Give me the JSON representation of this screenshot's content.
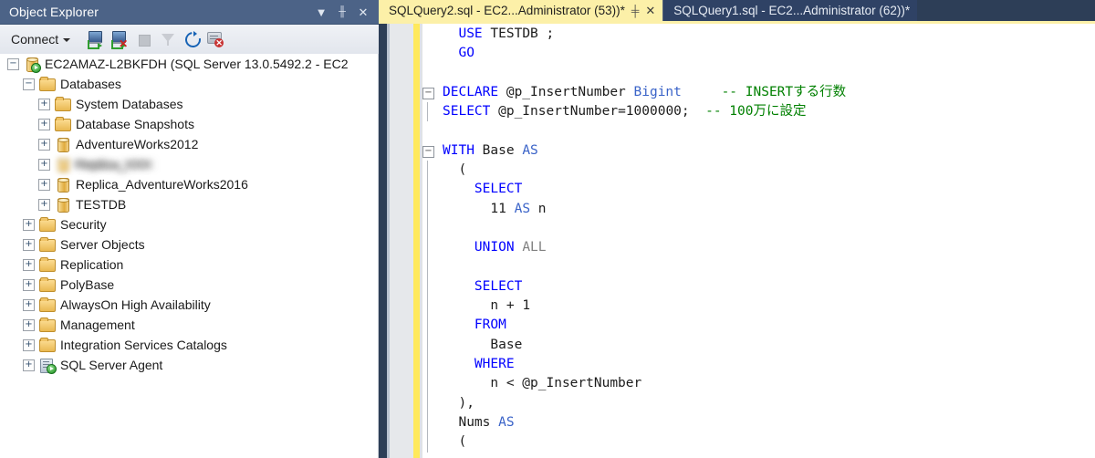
{
  "object_explorer": {
    "title": "Object Explorer",
    "title_buttons": [
      {
        "name": "dropdown",
        "glyph": "▼"
      },
      {
        "name": "pin",
        "glyph": "▮"
      },
      {
        "name": "close",
        "glyph": "✕"
      }
    ],
    "toolbar": {
      "connect_label": "Connect",
      "icons": [
        "connect-icon",
        "disconnect-icon",
        "stop-icon",
        "filter-icon",
        "refresh-icon",
        "disconnect-all-icon"
      ]
    },
    "tree": [
      {
        "label": "EC2AMAZ-L2BKFDH (SQL Server 13.0.5492.2 - EC2",
        "indent": 0,
        "expander": "−",
        "icon": "server-icon",
        "redacted": false
      },
      {
        "label": "Databases",
        "indent": 1,
        "expander": "−",
        "icon": "folder-icon",
        "redacted": false
      },
      {
        "label": "System Databases",
        "indent": 2,
        "expander": "+",
        "icon": "folder-icon",
        "redacted": false
      },
      {
        "label": "Database Snapshots",
        "indent": 2,
        "expander": "+",
        "icon": "folder-icon",
        "redacted": false
      },
      {
        "label": "AdventureWorks2012",
        "indent": 2,
        "expander": "+",
        "icon": "database-icon",
        "redacted": false
      },
      {
        "label": "Replica_XXX",
        "indent": 2,
        "expander": "+",
        "icon": "database-icon",
        "redacted": true
      },
      {
        "label": "Replica_AdventureWorks2016",
        "indent": 2,
        "expander": "+",
        "icon": "database-icon",
        "redacted": false
      },
      {
        "label": "TESTDB",
        "indent": 2,
        "expander": "+",
        "icon": "database-icon",
        "redacted": false
      },
      {
        "label": "Security",
        "indent": 1,
        "expander": "+",
        "icon": "folder-icon",
        "redacted": false
      },
      {
        "label": "Server Objects",
        "indent": 1,
        "expander": "+",
        "icon": "folder-icon",
        "redacted": false
      },
      {
        "label": "Replication",
        "indent": 1,
        "expander": "+",
        "icon": "folder-icon",
        "redacted": false
      },
      {
        "label": "PolyBase",
        "indent": 1,
        "expander": "+",
        "icon": "folder-icon",
        "redacted": false
      },
      {
        "label": "AlwaysOn High Availability",
        "indent": 1,
        "expander": "+",
        "icon": "folder-icon",
        "redacted": false
      },
      {
        "label": "Management",
        "indent": 1,
        "expander": "+",
        "icon": "folder-icon",
        "redacted": false
      },
      {
        "label": "Integration Services Catalogs",
        "indent": 1,
        "expander": "+",
        "icon": "folder-icon",
        "redacted": false
      },
      {
        "label": "SQL Server Agent",
        "indent": 1,
        "expander": "+",
        "icon": "agent-icon",
        "redacted": false
      }
    ]
  },
  "editor": {
    "tabs": [
      {
        "label": "SQLQuery2.sql - EC2...Administrator (53))*",
        "active": true,
        "pin_glyph": "⎯",
        "close_glyph": "✕"
      },
      {
        "label": "SQLQuery1.sql - EC2...Administrator (62))*",
        "active": false,
        "pin_glyph": "",
        "close_glyph": ""
      }
    ],
    "lines": [
      {
        "fold": "",
        "vline": false,
        "tokens": [
          {
            "t": "  ",
            "c": "plain"
          },
          {
            "t": "USE",
            "c": "kw"
          },
          {
            "t": " TESTDB ;",
            "c": "plain"
          }
        ]
      },
      {
        "fold": "",
        "vline": false,
        "tokens": [
          {
            "t": "  ",
            "c": "plain"
          },
          {
            "t": "GO",
            "c": "kw"
          }
        ]
      },
      {
        "fold": "",
        "vline": false,
        "tokens": []
      },
      {
        "fold": "−",
        "vline": false,
        "tokens": [
          {
            "t": "DECLARE",
            "c": "kw"
          },
          {
            "t": " @p_InsertNumber ",
            "c": "plain"
          },
          {
            "t": "Bigint",
            "c": "kw2"
          },
          {
            "t": "     ",
            "c": "plain"
          },
          {
            "t": "-- INSERTする行数",
            "c": "cmt"
          }
        ]
      },
      {
        "fold": "",
        "vline": true,
        "tokens": [
          {
            "t": "SELECT",
            "c": "kw"
          },
          {
            "t": " @p_InsertNumber=",
            "c": "plain"
          },
          {
            "t": "1000000",
            "c": "num"
          },
          {
            "t": ";  ",
            "c": "plain"
          },
          {
            "t": "-- 100万に設定",
            "c": "cmt"
          }
        ]
      },
      {
        "fold": "",
        "vline": false,
        "tokens": []
      },
      {
        "fold": "−",
        "vline": false,
        "tokens": [
          {
            "t": "WITH",
            "c": "kw"
          },
          {
            "t": " Base ",
            "c": "plain"
          },
          {
            "t": "AS",
            "c": "kw2"
          }
        ]
      },
      {
        "fold": "",
        "vline": true,
        "tokens": [
          {
            "t": "  (",
            "c": "plain"
          }
        ]
      },
      {
        "fold": "",
        "vline": true,
        "tokens": [
          {
            "t": "    ",
            "c": "plain"
          },
          {
            "t": "SELECT",
            "c": "kw"
          }
        ]
      },
      {
        "fold": "",
        "vline": true,
        "tokens": [
          {
            "t": "      ",
            "c": "plain"
          },
          {
            "t": "11",
            "c": "num"
          },
          {
            "t": " ",
            "c": "plain"
          },
          {
            "t": "AS",
            "c": "kw2"
          },
          {
            "t": " n",
            "c": "plain"
          }
        ]
      },
      {
        "fold": "",
        "vline": true,
        "tokens": []
      },
      {
        "fold": "",
        "vline": true,
        "tokens": [
          {
            "t": "    ",
            "c": "plain"
          },
          {
            "t": "UNION",
            "c": "kw"
          },
          {
            "t": " ",
            "c": "plain"
          },
          {
            "t": "ALL",
            "c": "gray"
          }
        ]
      },
      {
        "fold": "",
        "vline": true,
        "tokens": []
      },
      {
        "fold": "",
        "vline": true,
        "tokens": [
          {
            "t": "    ",
            "c": "plain"
          },
          {
            "t": "SELECT",
            "c": "kw"
          }
        ]
      },
      {
        "fold": "",
        "vline": true,
        "tokens": [
          {
            "t": "      n + ",
            "c": "plain"
          },
          {
            "t": "1",
            "c": "num"
          }
        ]
      },
      {
        "fold": "",
        "vline": true,
        "tokens": [
          {
            "t": "    ",
            "c": "plain"
          },
          {
            "t": "FROM",
            "c": "kw"
          }
        ]
      },
      {
        "fold": "",
        "vline": true,
        "tokens": [
          {
            "t": "      Base",
            "c": "plain"
          }
        ]
      },
      {
        "fold": "",
        "vline": true,
        "tokens": [
          {
            "t": "    ",
            "c": "plain"
          },
          {
            "t": "WHERE",
            "c": "kw"
          }
        ]
      },
      {
        "fold": "",
        "vline": true,
        "tokens": [
          {
            "t": "      n < @p_InsertNumber",
            "c": "plain"
          }
        ]
      },
      {
        "fold": "",
        "vline": true,
        "tokens": [
          {
            "t": "  ),",
            "c": "plain"
          }
        ]
      },
      {
        "fold": "",
        "vline": true,
        "tokens": [
          {
            "t": "  Nums ",
            "c": "plain"
          },
          {
            "t": "AS",
            "c": "kw2"
          }
        ]
      },
      {
        "fold": "",
        "vline": true,
        "tokens": [
          {
            "t": "  (",
            "c": "plain"
          }
        ]
      }
    ]
  },
  "colors": {
    "titlebar": "#4c6387",
    "tab_active": "#fcf0a8",
    "tab_inactive": "#2f4265",
    "tabstrip": "#2d3e57",
    "keyword": "#0000ff",
    "comment": "#008000",
    "change_bar": "#ffe95c"
  }
}
